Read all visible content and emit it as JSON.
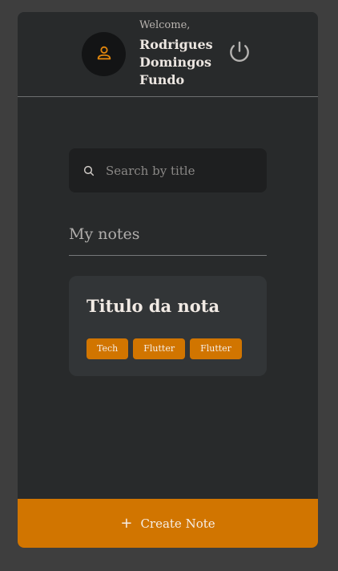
{
  "header": {
    "welcome_label": "Welcome,",
    "user_name_lines": [
      "Rodrigues",
      "Domingos",
      "Fundo"
    ],
    "avatar_icon": "user-icon",
    "logout_icon": "power-icon"
  },
  "search": {
    "placeholder": "Search by title",
    "value": "",
    "icon": "search-icon"
  },
  "notes_section": {
    "title": "My notes",
    "notes": [
      {
        "title": "Titulo da nota",
        "tags": [
          "Tech",
          "Flutter",
          "Flutter"
        ]
      }
    ]
  },
  "create_note": {
    "label": "Create Note",
    "icon": "plus-icon"
  },
  "colors": {
    "background": "#3e3e3e",
    "panel": "#282a2b",
    "card": "#323537",
    "accent": "#d17500",
    "avatar_bg": "#131415"
  }
}
